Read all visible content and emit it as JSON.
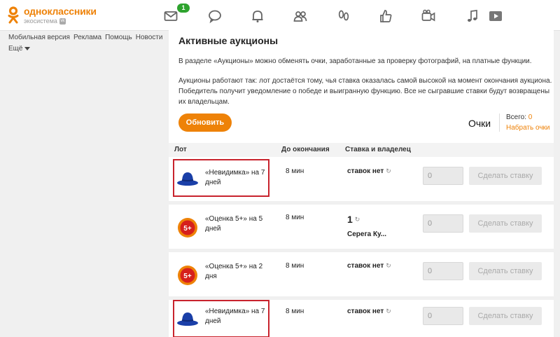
{
  "header": {
    "logo_title": "одноклассники",
    "logo_sub": "экосистема",
    "logo_vk": "vk",
    "messages_badge": "1",
    "icons": [
      "mail-icon",
      "chat-icon",
      "bell-icon",
      "friends-icon",
      "footprints-icon",
      "like-icon",
      "video-call-icon",
      "music-icon",
      "video-icon"
    ]
  },
  "sidebar": {
    "links": [
      "Мобильная версия",
      "Реклама",
      "Помощь",
      "Новости"
    ],
    "more": "Ещё"
  },
  "main": {
    "title": "Активные аукционы",
    "desc1": "В разделе «Аукционы» можно обменять очки, заработанные за проверку фотографий, на платные функции.",
    "desc2": "Аукционы работают так: лот достаётся тому, чья ставка оказалась самой высокой на момент окончания аукциона. Победитель получит уведомление о победе и выигранную функцию. Все не сыгравшие ставки будут возвращены их владельцам.",
    "refresh_button": "Обновить",
    "points_label": "Очки",
    "total_label": "Всего:",
    "total_value": "0",
    "collect_points": "Набрать очки",
    "columns": {
      "lot": "Лот",
      "ends": "До окончания",
      "bid_owner": "Ставка и владелец"
    },
    "rows": [
      {
        "icon": "hat-icon",
        "name": "«Невидимка» на 7 дней",
        "time": "8 мин",
        "bid": "ставок нет",
        "owner": "",
        "input": "0",
        "button": "Сделать ставку",
        "highlighted": true
      },
      {
        "icon": "five-plus-icon",
        "name": "«Оценка 5+» на 5 дней",
        "time": "8 мин",
        "bid": "1",
        "owner": "Серега Ку...",
        "input": "0",
        "button": "Сделать ставку",
        "highlighted": false
      },
      {
        "icon": "five-plus-icon",
        "name": "«Оценка 5+» на 2 дня",
        "time": "8 мин",
        "bid": "ставок нет",
        "owner": "",
        "input": "0",
        "button": "Сделать ставку",
        "highlighted": false
      },
      {
        "icon": "hat-icon",
        "name": "«Невидимка» на 7 дней",
        "time": "8 мин",
        "bid": "ставок нет",
        "owner": "",
        "input": "0",
        "button": "Сделать ставку",
        "highlighted": true
      }
    ],
    "reload_glyph": "↻",
    "five_plus_text": "5+"
  },
  "colors": {
    "brand": "#ee8208",
    "highlight": "#c8232d",
    "badge": "#2ea32e",
    "hat": "#1a3fa8"
  }
}
